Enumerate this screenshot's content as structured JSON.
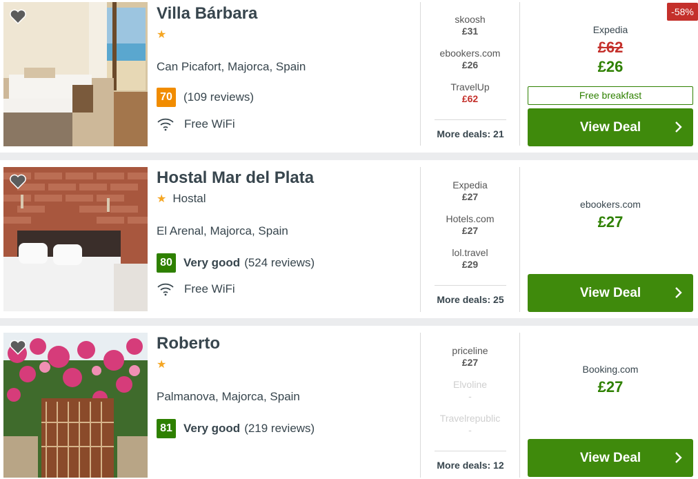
{
  "colors": {
    "accent_green": "#3f8a0c",
    "price_green": "#2e8000",
    "price_red": "#c4302b",
    "score_orange": "#f18c00",
    "star": "#f5a623"
  },
  "hotels": [
    {
      "name": "Villa Bárbara",
      "stars": "★",
      "type": "",
      "location": "Can Picafort, Majorca, Spain",
      "score": "70",
      "rating_word": "",
      "reviews": "(109 reviews)",
      "amenity": "Free WiFi",
      "deals": [
        {
          "provider": "skoosh",
          "price": "£31"
        },
        {
          "provider": "ebookers.com",
          "price": "£26"
        },
        {
          "provider": "TravelUp",
          "price": "£62"
        }
      ],
      "more_deals": "More deals: 21",
      "best_provider": "Expedia",
      "old_price": "£62",
      "price": "£26",
      "perk": "Free breakfast",
      "discount": "-58%",
      "cta": "View Deal"
    },
    {
      "name": "Hostal Mar del Plata",
      "stars": "★",
      "type": "Hostal",
      "location": "El Arenal, Majorca, Spain",
      "score": "80",
      "rating_word": "Very good",
      "reviews": "(524 reviews)",
      "amenity": "Free WiFi",
      "deals": [
        {
          "provider": "Expedia",
          "price": "£27"
        },
        {
          "provider": "Hotels.com",
          "price": "£27"
        },
        {
          "provider": "lol.travel",
          "price": "£29"
        }
      ],
      "more_deals": "More deals: 25",
      "best_provider": "ebookers.com",
      "price": "£27",
      "cta": "View Deal"
    },
    {
      "name": "Roberto",
      "stars": "★",
      "type": "",
      "location": "Palmanova, Majorca, Spain",
      "score": "81",
      "rating_word": "Very good",
      "reviews": "(219 reviews)",
      "deals": [
        {
          "provider": "priceline",
          "price": "£27"
        },
        {
          "provider": "Elvoline",
          "price": "-"
        },
        {
          "provider": "Travelrepublic",
          "price": "-"
        }
      ],
      "more_deals": "More deals: 12",
      "best_provider": "Booking.com",
      "price": "£27",
      "cta": "View Deal"
    }
  ]
}
